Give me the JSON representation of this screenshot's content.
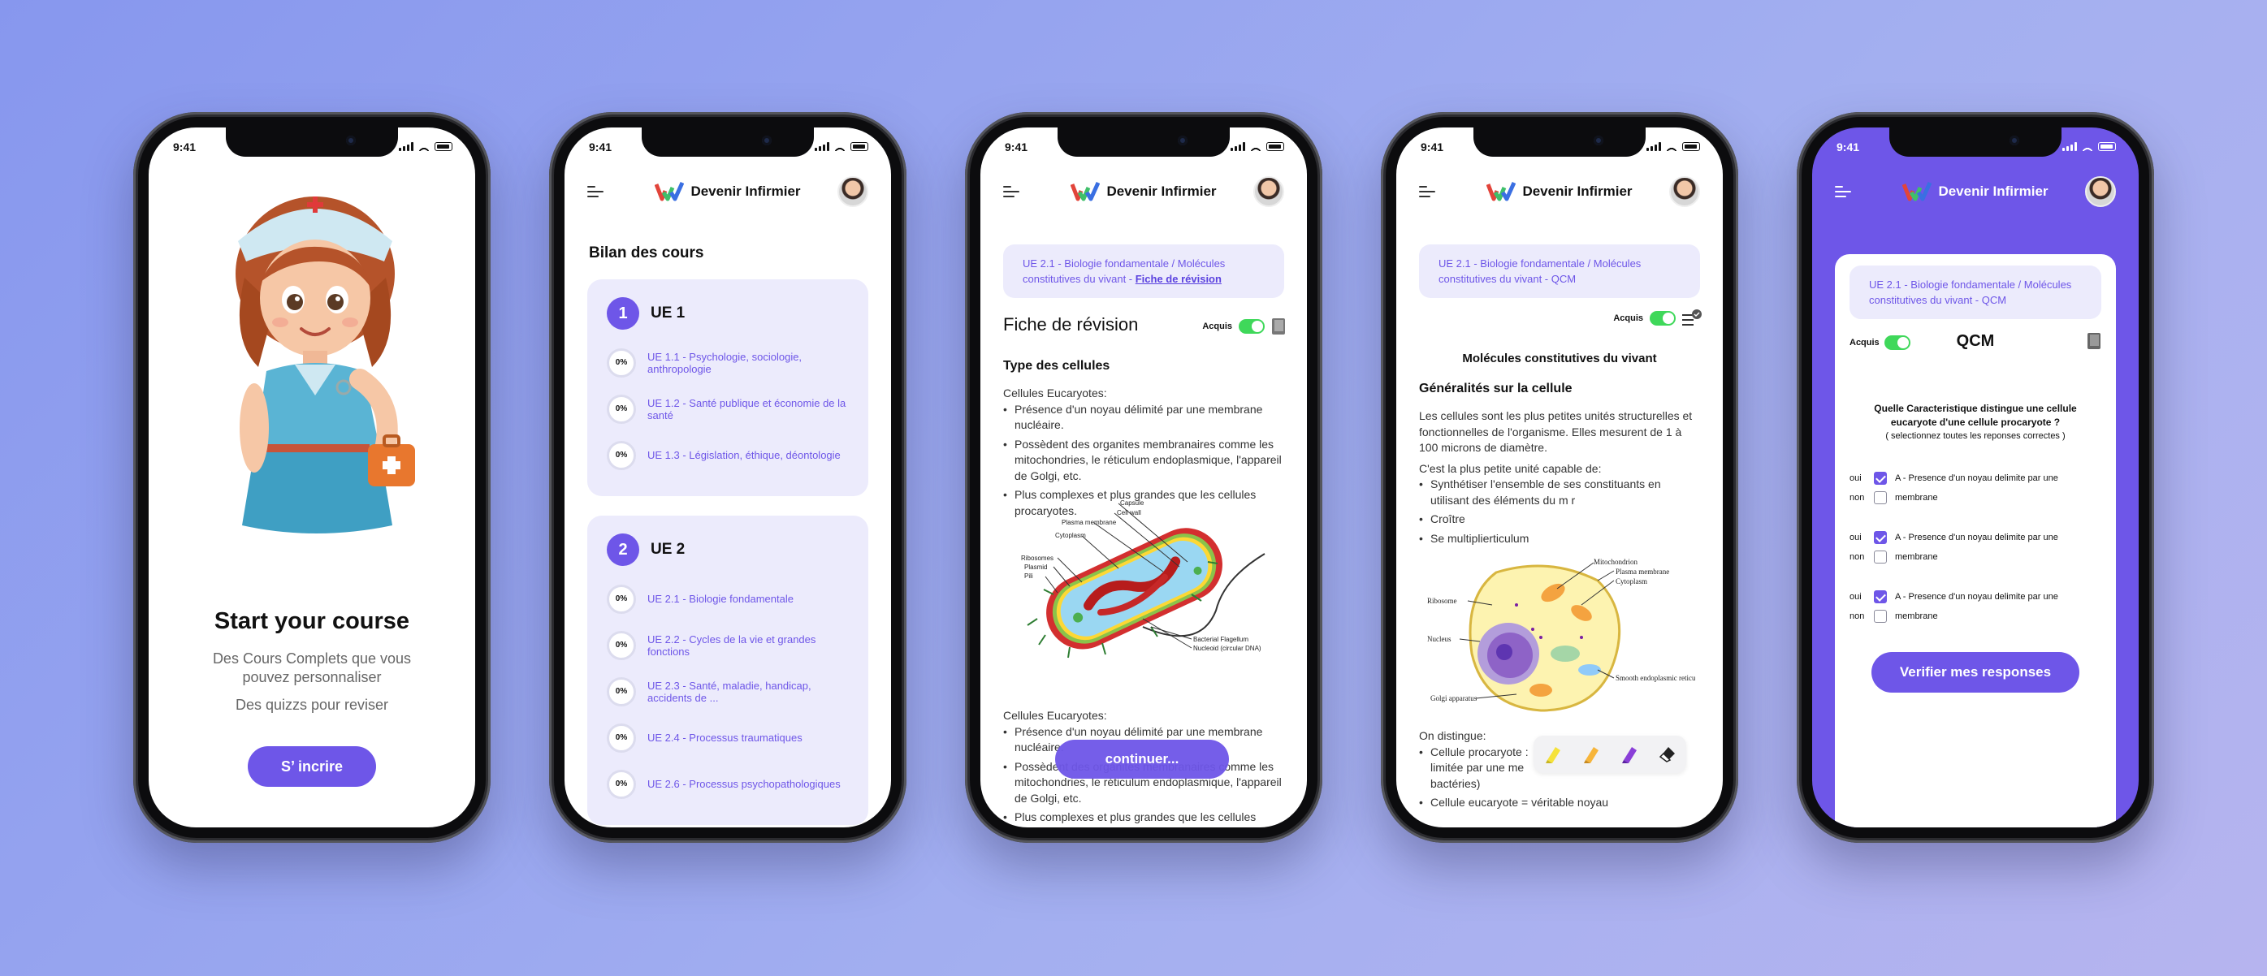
{
  "statusbar": {
    "time": "9:41"
  },
  "app": {
    "name": "Devenir Infirmier"
  },
  "onboarding": {
    "title": "Start your course",
    "line1": "Des Cours Complets que vous pouvez personnaliser",
    "line2": "Des quizzs pour reviser",
    "cta": "S’ incrire"
  },
  "bilan": {
    "title": "Bilan des cours",
    "ue1": {
      "num": "1",
      "title": "UE 1",
      "items": [
        {
          "pct": "0%",
          "label": "UE 1.1 - Psychologie, sociologie, anthropologie"
        },
        {
          "pct": "0%",
          "label": "UE 1.2 - Santé publique et économie de la santé"
        },
        {
          "pct": "0%",
          "label": "UE 1.3 - Législation, éthique, déontologie"
        }
      ]
    },
    "ue2": {
      "num": "2",
      "title": "UE 2",
      "items": [
        {
          "pct": "0%",
          "label": "UE 2.1 - Biologie fondamentale"
        },
        {
          "pct": "0%",
          "label": "UE 2.2 - Cycles de la vie et grandes fonctions"
        },
        {
          "pct": "0%",
          "label": "UE 2.3 - Santé, maladie, handicap, accidents de ..."
        },
        {
          "pct": "0%",
          "label": "UE 2.4 - Processus traumatiques"
        },
        {
          "pct": "0%",
          "label": "UE 2.6 - Processus psychopathologiques"
        }
      ]
    }
  },
  "fiche": {
    "breadcrumb": "UE 2.1 - Biologie fondamentale / Molécules constitutives du vivant - ",
    "breadcrumb_link": "Fiche de révision",
    "title": "Fiche de révision",
    "acquis": "Acquis",
    "section": "Type des cellules",
    "sub1": "Cellules Eucaryotes:",
    "bullets1": [
      "Présence d'un noyau délimité par une membrane nucléaire.",
      "Possèdent des organites membranaires comme les mitochondries, le réticulum endoplasmique, l'appareil de Golgi, etc.",
      "Plus complexes et plus grandes que les cellules procaryotes."
    ],
    "diagram_labels": [
      "Capsule",
      "Cell wall",
      "Plasma membrane",
      "Cytoplasm",
      "Ribosomes",
      "Plasmid",
      "Pili",
      "Bacterial Flagellum",
      "Nucleoid (circular DNA)"
    ],
    "sub2": "Cellules Eucaryotes:",
    "bullets2": [
      "Présence d'un noyau délimité par une membrane nucléaire.",
      "Possèdent des organites membranaires comme les mitochondries, le réticulum endoplasmique, l'appareil de Golgi, etc.",
      "Plus complexes et plus grandes que les cellules"
    ],
    "continue": "continuer..."
  },
  "notes": {
    "breadcrumb": "UE 2.1 - Biologie fondamentale / Molécules constitutives du vivant - QCM",
    "acquis": "Acquis",
    "heading": "Molécules constitutives du vivant",
    "section": "Généralités sur la cellule",
    "para": "Les cellules sont les plus petites unités structurelles et fonctionnelles de l'organisme. Elles mesurent de 1 à 100 microns de diamètre.",
    "para2": "C'est la plus petite unité capable de:",
    "bullets": [
      "Synthétiser l'ensemble de ses constituants en utilisant des éléments du m r",
      "Croître",
      "Se multiplierticulum"
    ],
    "diagram_labels": [
      "Mitochondrion",
      "Plasma membrane",
      "Cytoplasm",
      "Ribosome",
      "Nucleus",
      "Smooth endoplasmic reticulum",
      "Golgi apparatus"
    ],
    "distinguish": "On distingue:",
    "bullets2": [
      "Cellule procaryote : limitée par une me bactéries)",
      "Cellule eucaryote = véritable noyau"
    ],
    "tools": [
      "highlighter-yellow",
      "highlighter-orange",
      "highlighter-purple",
      "eraser"
    ]
  },
  "qcm": {
    "breadcrumb": "UE 2.1 - Biologie fondamentale / Molécules constitutives du vivant - QCM",
    "acquis": "Acquis",
    "title": "QCM",
    "question": "Quelle Caracteristique distingue une cellule eucaryote d'une cellule procaryote ?",
    "hint": "( selectionnez toutes les reponses correctes )",
    "answers": [
      {
        "oui": "oui",
        "non": "non",
        "line1": "A - Presence d'un noyau delimite par une",
        "line2": "membrane"
      },
      {
        "oui": "oui",
        "non": "non",
        "line1": "A - Presence d'un noyau delimite par une",
        "line2": "membrane"
      },
      {
        "oui": "oui",
        "non": "non",
        "line1": "A - Presence d'un noyau delimite par une",
        "line2": "membrane"
      }
    ],
    "submit": "Verifier mes responses"
  },
  "colors": {
    "accent": "#6e56e8",
    "accent_light": "#ecebfc",
    "toggle_on": "#3fd85a"
  }
}
